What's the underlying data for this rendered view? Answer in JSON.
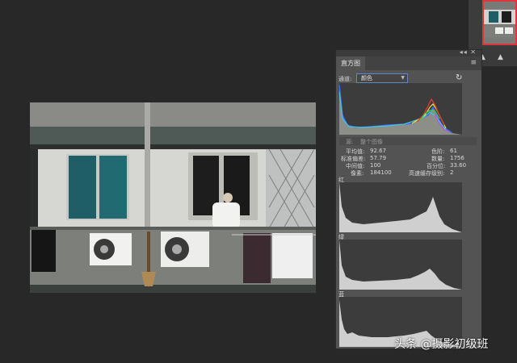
{
  "panel": {
    "title": "直方图",
    "channel_label": "通道:",
    "channel_value": "颜色",
    "source_label": "源:",
    "source_value": "整个图像"
  },
  "stats": {
    "mean_label": "平均值:",
    "mean": "92.67",
    "level_label": "色阶:",
    "level": "61",
    "std_label": "标准偏差:",
    "std": "57.79",
    "count_label": "数量:",
    "count": "1756",
    "median_label": "中间值:",
    "median": "100",
    "percentile_label": "百分位:",
    "percentile": "33.60",
    "pixels_label": "像素:",
    "pixels": "184100",
    "cache_label": "高速缓存级别:",
    "cache": "2"
  },
  "channels": {
    "red": "红",
    "green": "绿",
    "blue": "蓝"
  },
  "watermark": "头条 @摄影初级班",
  "icons": {
    "refresh": "refresh-icon",
    "warning": "warning-icon",
    "menu": "menu-icon"
  },
  "colors": {
    "panel_bg": "#535353",
    "app_bg": "#282828",
    "highlight": "#e0353a"
  }
}
